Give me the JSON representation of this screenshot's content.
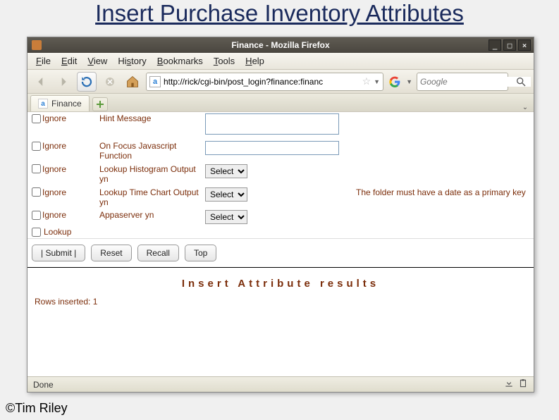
{
  "slide": {
    "title": "Insert Purchase Inventory Attributes",
    "copyright": "©Tim Riley"
  },
  "window": {
    "title": "Finance - Mozilla Firefox"
  },
  "menu": {
    "file": "File",
    "edit": "Edit",
    "view": "View",
    "history": "History",
    "bookmarks": "Bookmarks",
    "tools": "Tools",
    "help": "Help"
  },
  "nav": {
    "url": "http://rick/cgi-bin/post_login?finance:financ",
    "search_placeholder": "Google"
  },
  "tab": {
    "label": "Finance"
  },
  "form": {
    "ignore": "Ignore",
    "lookup": "Lookup",
    "rows": [
      {
        "label": "Hint Message"
      },
      {
        "label": "On Focus Javascript Function"
      },
      {
        "label": "Lookup Histogram Output yn"
      },
      {
        "label": "Lookup Time Chart Output yn",
        "note": "The folder must have a date as a primary key"
      },
      {
        "label": "Appaserver yn"
      }
    ],
    "select_placeholder": "Select",
    "buttons": {
      "submit": "|   Submit   |",
      "reset": "Reset",
      "recall": "Recall",
      "top": "Top"
    }
  },
  "results": {
    "heading": "Insert Attribute results",
    "rows_inserted": "Rows inserted: 1"
  },
  "status": {
    "text": "Done"
  }
}
